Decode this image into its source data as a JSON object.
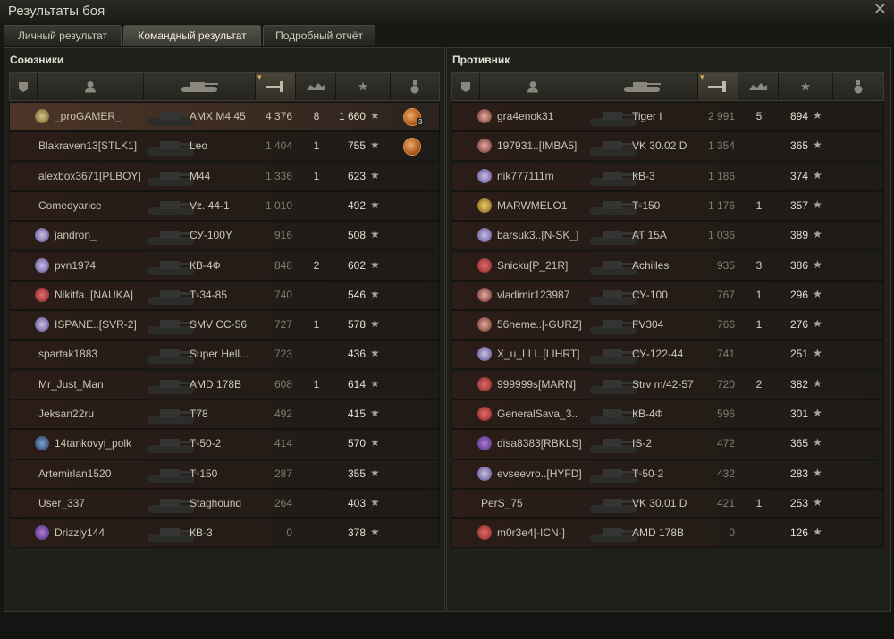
{
  "window": {
    "title": "Результаты боя",
    "close_icon": "close-icon"
  },
  "tabs": [
    {
      "label": "Личный результат",
      "active": false
    },
    {
      "label": "Командный результат",
      "active": true
    },
    {
      "label": "Подробный отчёт",
      "active": false
    }
  ],
  "columns": [
    "platoon-icon",
    "player-icon",
    "tank-icon",
    "damage-icon",
    "kills-icon",
    "xp-star-icon",
    "medal-icon"
  ],
  "colors": {
    "accent": "#e0b060",
    "row_bg": "#2b1d17",
    "highlight_row": "#4b3526"
  },
  "allies": {
    "title": "Союзники",
    "rows": [
      {
        "badge": "tier-badge-shield",
        "player": "_proGAMER_",
        "tank": "AMX M4 45",
        "damage": "4 376",
        "kills": "8",
        "xp": "1 660",
        "medal": "3",
        "highlight": true
      },
      {
        "badge": "",
        "player": "Blakraven13[STLK1]",
        "tank": "Leo",
        "damage": "1 404",
        "kills": "1",
        "xp": "755",
        "medal": "1",
        "highlight": false
      },
      {
        "badge": "",
        "player": "alexbox3671[PLBOY]",
        "tank": "M44",
        "damage": "1 336",
        "kills": "1",
        "xp": "623",
        "medal": "",
        "highlight": false
      },
      {
        "badge": "",
        "player": "Comedyarice",
        "tank": "Vz. 44-1",
        "damage": "1 010",
        "kills": "",
        "xp": "492",
        "medal": "",
        "highlight": false
      },
      {
        "badge": "tier-badge-star",
        "player": "jandron_",
        "tank": "СУ-100Y",
        "damage": "916",
        "kills": "",
        "xp": "508",
        "medal": "",
        "highlight": false
      },
      {
        "badge": "tier-badge-star",
        "player": "pvn1974",
        "tank": "КВ-4Ф",
        "damage": "848",
        "kills": "2",
        "xp": "602",
        "medal": "",
        "highlight": false
      },
      {
        "badge": "tier-badge-red",
        "player": "Nikitfa..[NAUKA]",
        "tank": "Т-34-85",
        "damage": "740",
        "kills": "",
        "xp": "546",
        "medal": "",
        "highlight": false
      },
      {
        "badge": "tier-badge-star",
        "player": "ISPANE..[SVR-2]",
        "tank": "SMV CC-56",
        "damage": "727",
        "kills": "1",
        "xp": "578",
        "medal": "",
        "highlight": false
      },
      {
        "badge": "",
        "player": "spartak1883",
        "tank": "Super Hell...",
        "damage": "723",
        "kills": "",
        "xp": "436",
        "medal": "",
        "highlight": false
      },
      {
        "badge": "",
        "player": "Mr_Just_Man",
        "tank": "AMD 178B",
        "damage": "608",
        "kills": "1",
        "xp": "614",
        "medal": "",
        "highlight": false
      },
      {
        "badge": "",
        "player": "Jeksan22ru",
        "tank": "T78",
        "damage": "492",
        "kills": "",
        "xp": "415",
        "medal": "",
        "highlight": false
      },
      {
        "badge": "tier-badge-vii",
        "player": "14tankovyi_polk",
        "tank": "Т-50-2",
        "damage": "414",
        "kills": "",
        "xp": "570",
        "medal": "",
        "highlight": false
      },
      {
        "badge": "",
        "player": "Artemirlan1520",
        "tank": "Т-150",
        "damage": "287",
        "kills": "",
        "xp": "355",
        "medal": "",
        "highlight": false
      },
      {
        "badge": "",
        "player": "User_337",
        "tank": "Staghound",
        "damage": "264",
        "kills": "",
        "xp": "403",
        "medal": "",
        "highlight": false
      },
      {
        "badge": "tier-badge-purple",
        "player": "Drizzly144",
        "tank": "КВ-3",
        "damage": "0",
        "kills": "",
        "xp": "378",
        "medal": "",
        "highlight": false
      }
    ]
  },
  "enemies": {
    "title": "Противник",
    "rows": [
      {
        "badge": "tier-badge-diamond",
        "player": "gra4enok31",
        "tank": "Tiger I",
        "damage": "2 991",
        "kills": "5",
        "xp": "894",
        "medal": "",
        "highlight": false
      },
      {
        "badge": "tier-badge-diamond",
        "player": "197931..[IMBA5]",
        "tank": "VK 30.02 D",
        "damage": "1 354",
        "kills": "",
        "xp": "365",
        "medal": "",
        "highlight": false
      },
      {
        "badge": "tier-badge-star",
        "player": "nik777111m",
        "tank": "КВ-3",
        "damage": "1 186",
        "kills": "",
        "xp": "374",
        "medal": "",
        "highlight": false
      },
      {
        "badge": "tier-badge-gold",
        "player": "MARWMELO1",
        "tank": "Т-150",
        "damage": "1 176",
        "kills": "1",
        "xp": "357",
        "medal": "",
        "highlight": false
      },
      {
        "badge": "tier-badge-star",
        "player": "barsuk3..[N-SK_]",
        "tank": "AT 15A",
        "damage": "1 036",
        "kills": "",
        "xp": "389",
        "medal": "",
        "highlight": false
      },
      {
        "badge": "tier-badge-red",
        "player": "Snicku[P_21R]",
        "tank": "Achilles",
        "damage": "935",
        "kills": "3",
        "xp": "386",
        "medal": "",
        "highlight": false
      },
      {
        "badge": "tier-badge-diamond",
        "player": "vladimir123987",
        "tank": "СУ-100",
        "damage": "767",
        "kills": "1",
        "xp": "296",
        "medal": "",
        "highlight": false
      },
      {
        "badge": "tier-badge-diamond",
        "player": "56neme..[-GURZ]",
        "tank": "FV304",
        "damage": "766",
        "kills": "1",
        "xp": "276",
        "medal": "",
        "highlight": false
      },
      {
        "badge": "tier-badge-star",
        "player": "X_u_LLI..[LIHRT]",
        "tank": "СУ-122-44",
        "damage": "741",
        "kills": "",
        "xp": "251",
        "medal": "",
        "highlight": false
      },
      {
        "badge": "tier-badge-red",
        "player": "999999s[MARN]",
        "tank": "Strv m/42-57",
        "damage": "720",
        "kills": "2",
        "xp": "382",
        "medal": "",
        "highlight": false
      },
      {
        "badge": "tier-badge-red",
        "player": "GeneralSava_3..",
        "tank": "КВ-4Ф",
        "damage": "596",
        "kills": "",
        "xp": "301",
        "medal": "",
        "highlight": false
      },
      {
        "badge": "tier-badge-purple",
        "player": "disa8383[RBKLS]",
        "tank": "IS-2",
        "damage": "472",
        "kills": "",
        "xp": "365",
        "medal": "",
        "highlight": false
      },
      {
        "badge": "tier-badge-star",
        "player": "evseevro..[HYFD]",
        "tank": "Т-50-2",
        "damage": "432",
        "kills": "",
        "xp": "283",
        "medal": "",
        "highlight": false
      },
      {
        "badge": "",
        "player": "PerS_75",
        "tank": "VK 30.01 D",
        "damage": "421",
        "kills": "1",
        "xp": "253",
        "medal": "",
        "highlight": false
      },
      {
        "badge": "tier-badge-red",
        "player": "m0r3e4[-ICN-]",
        "tank": "AMD 178B",
        "damage": "0",
        "kills": "",
        "xp": "126",
        "medal": "",
        "highlight": false
      }
    ]
  }
}
